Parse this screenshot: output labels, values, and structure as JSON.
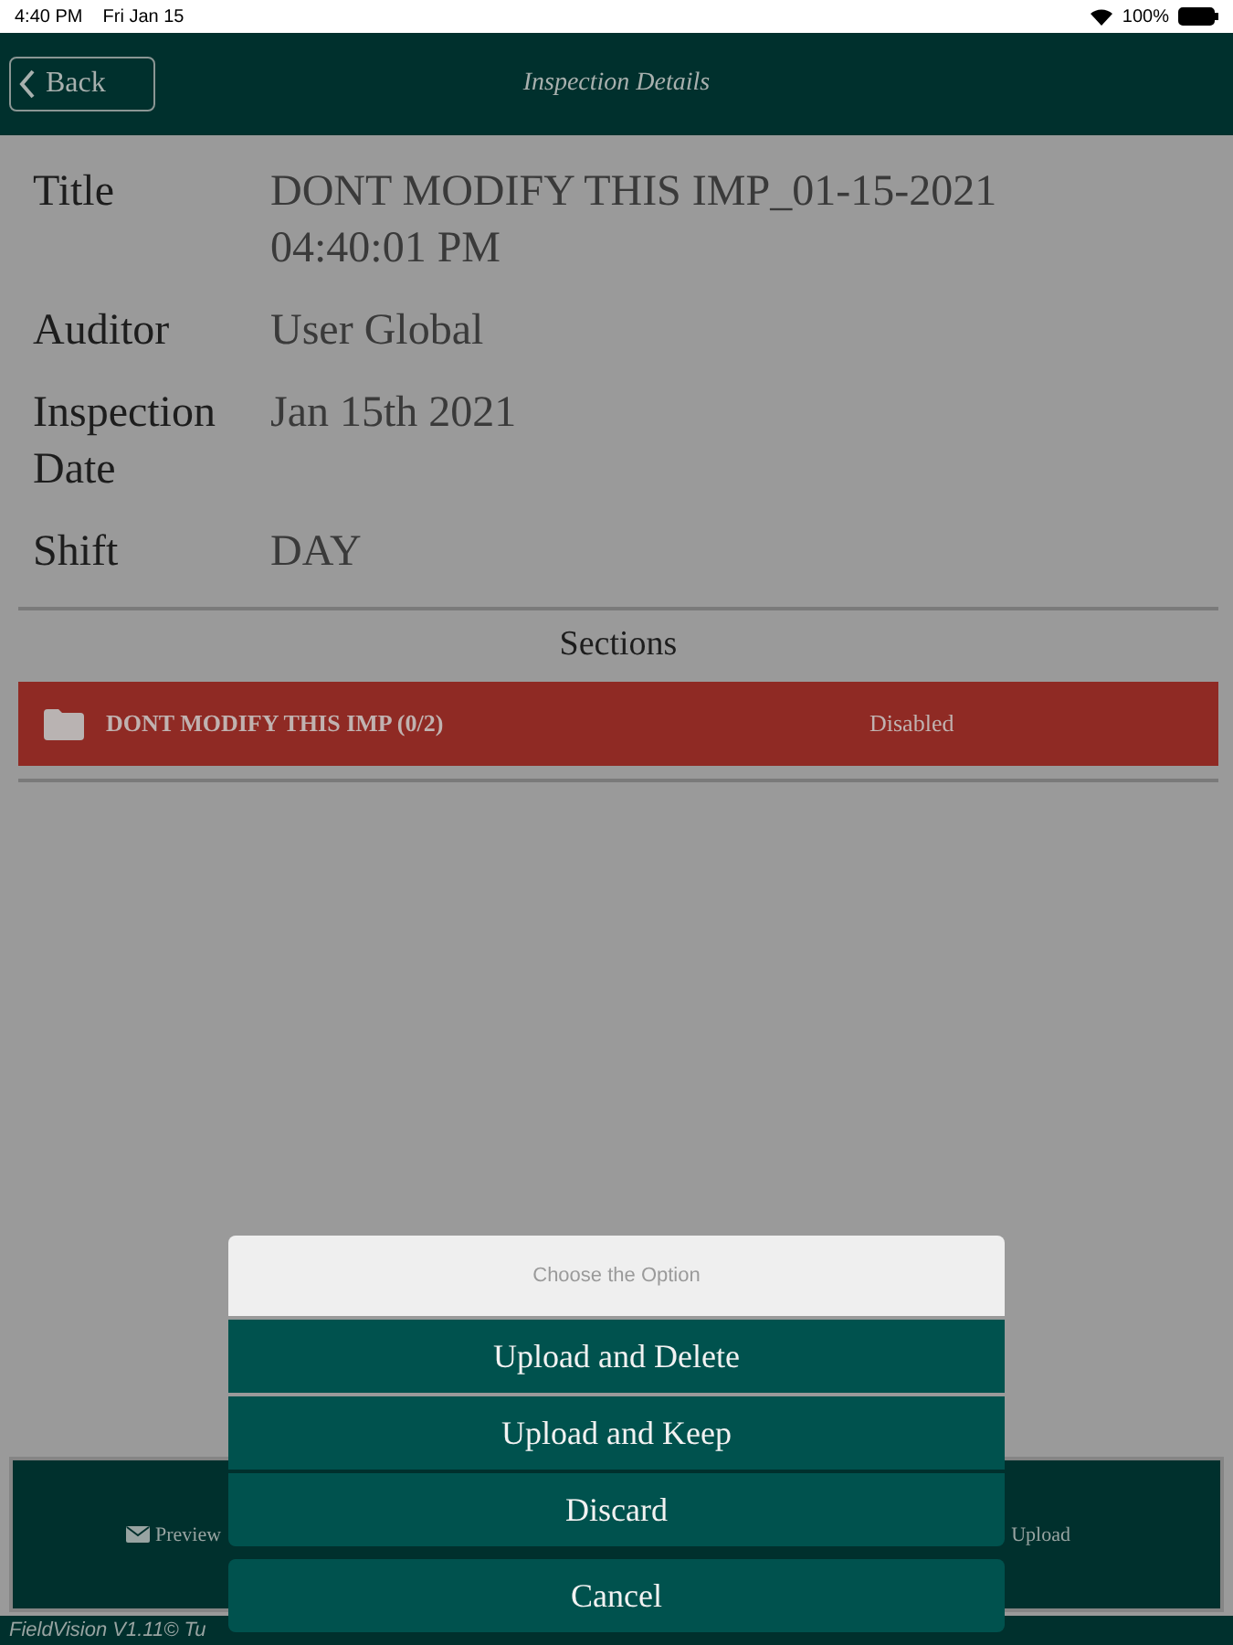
{
  "status_bar": {
    "time": "4:40 PM",
    "date": "Fri Jan 15",
    "battery": "100%"
  },
  "header": {
    "back_button": "Back",
    "title": "Inspection Details"
  },
  "fields": [
    {
      "label": "Title",
      "value": "DONT MODIFY THIS IMP_01-15-2021 04:40:01 PM"
    },
    {
      "label": "Auditor",
      "value": "User Global"
    },
    {
      "label": "Inspection Date",
      "value": "Jan 15th 2021"
    },
    {
      "label": "Shift",
      "value": "DAY"
    }
  ],
  "sections": {
    "heading": "Sections",
    "items": [
      {
        "name": "DONT MODIFY THIS IMP (0/2)",
        "status": "Disabled"
      }
    ]
  },
  "toolbar": {
    "items": [
      {
        "label": "Preview",
        "kind": "mail"
      },
      {
        "label": "Upload",
        "kind": "plain"
      }
    ]
  },
  "footer": "FieldVision V1.11© Tu",
  "action_sheet": {
    "title": "Choose the Option",
    "options": [
      "Upload and Delete",
      "Upload and Keep",
      "Discard"
    ],
    "cancel": "Cancel"
  }
}
